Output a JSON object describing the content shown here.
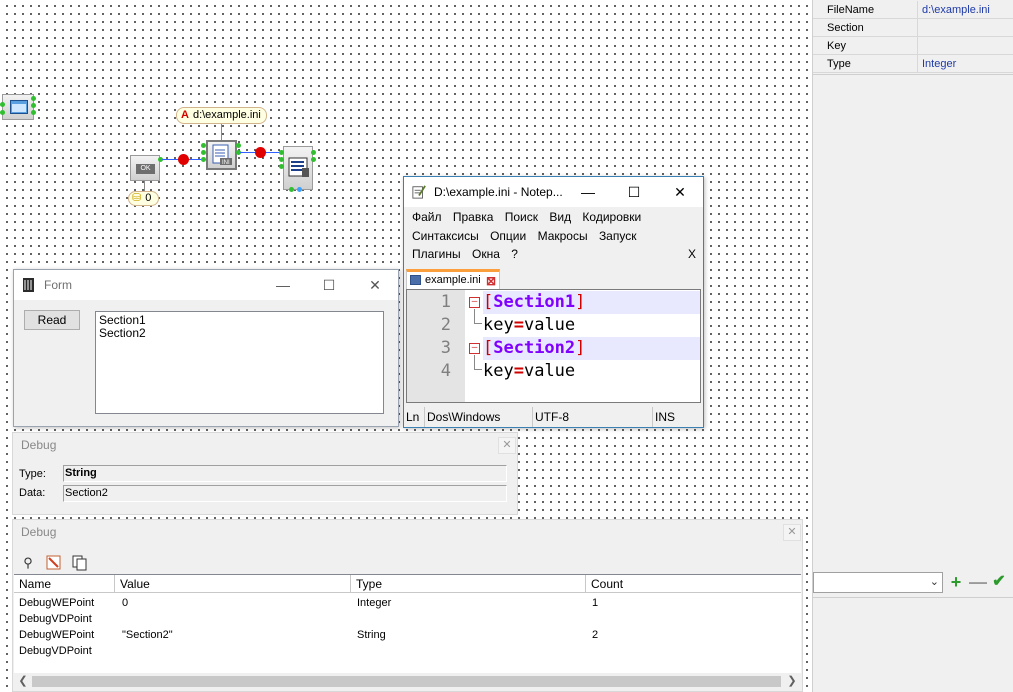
{
  "properties": {
    "rows": [
      {
        "name": "FileName",
        "value": "d:\\example.ini"
      },
      {
        "name": "Section",
        "value": ""
      },
      {
        "name": "Key",
        "value": ""
      },
      {
        "name": "Type",
        "value": "Integer"
      }
    ],
    "combo_value": "",
    "add_icon": "plus-icon",
    "remove_icon": "minus-icon",
    "apply_icon": "check-icon"
  },
  "schema": {
    "ini_label": "d:\\example.ini",
    "ini_label_icon": "A",
    "counter_label": "0",
    "button_component_text": "OK",
    "ini_component_text": "INI"
  },
  "form_window": {
    "title": "Form",
    "button_label": "Read",
    "list_items": [
      "Section1",
      "Section2"
    ]
  },
  "debug_small": {
    "title": "Debug",
    "type_label": "Type:",
    "type_value": "String",
    "data_label": "Data:",
    "data_value": "Section2"
  },
  "debug_big": {
    "title": "Debug",
    "columns": [
      "Name",
      "Value",
      "Type",
      "Count"
    ],
    "rows": [
      {
        "name": "DebugWEPoint",
        "value": "0",
        "type": "Integer",
        "count": "1"
      },
      {
        "name": "DebugVDPoint",
        "value": "",
        "type": "",
        "count": ""
      },
      {
        "name": "DebugWEPoint",
        "value": "\"Section2\"",
        "type": "String",
        "count": "2"
      },
      {
        "name": "DebugVDPoint",
        "value": "",
        "type": "",
        "count": ""
      }
    ]
  },
  "notepad": {
    "title": "D:\\example.ini - Notep...",
    "menu_row1": [
      "Файл",
      "Правка",
      "Поиск",
      "Вид",
      "Кодировки"
    ],
    "menu_row2": [
      "Синтаксисы",
      "Опции",
      "Макросы",
      "Запуск"
    ],
    "menu_row3": [
      "Плагины",
      "Окна",
      "?"
    ],
    "menu_close": "X",
    "tab_label": "example.ini",
    "lines": [
      {
        "num": "1",
        "open": "[",
        "text": "Section1",
        "close": "]"
      },
      {
        "num": "2",
        "key": "key",
        "eq": "=",
        "val": "value"
      },
      {
        "num": "3",
        "open": "[",
        "text": "Section2",
        "close": "]"
      },
      {
        "num": "4",
        "key": "key",
        "eq": "=",
        "val": "value"
      }
    ],
    "status": {
      "ln": "Ln",
      "eol": "Dos\\Windows",
      "enc": "UTF-8",
      "mode": "INS"
    }
  },
  "window_controls": {
    "minimize": "—",
    "maximize": "☐",
    "close": "✕"
  },
  "colors": {
    "accent_tab": "#fb9f3d",
    "wire": "#3060ff",
    "pin": "#2fbf2f",
    "redpoint": "#e00000"
  }
}
